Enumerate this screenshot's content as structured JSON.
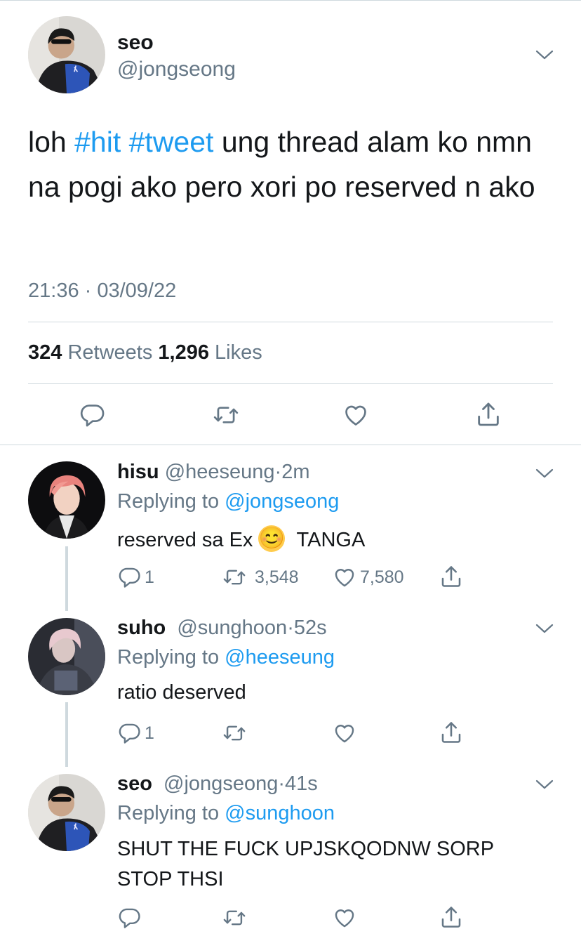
{
  "main_tweet": {
    "display_name": "seo",
    "handle": "@jongseong",
    "text_parts": [
      "loh ",
      "#hit",
      " ",
      "#tweet",
      " ung thread alam ko nmn na pogi ako pero xori po reserved n ako"
    ],
    "timestamp": "21:36 · 03/09/22",
    "retweets_count": "324",
    "retweets_label": "Retweets",
    "likes_count": "1,296",
    "likes_label": "Likes"
  },
  "replies": [
    {
      "display_name": "hisu",
      "handle": "@heeseung",
      "age": "2m",
      "replying_label": "Replying to",
      "replying_to": "@jongseong",
      "text_before": "reserved sa Ex",
      "emoji": "😊",
      "text_after": "TANGA",
      "reply_count": "1",
      "retweet_count": "3,548",
      "like_count": "7,580"
    },
    {
      "display_name": "suho",
      "handle": "@sunghoon",
      "age": "52s",
      "replying_label": "Replying to",
      "replying_to": "@heeseung",
      "text": "ratio deserved",
      "reply_count": "1"
    },
    {
      "display_name": "seo",
      "handle": "@jongseong",
      "age": "41s",
      "replying_label": "Replying to",
      "replying_to": "@sunghoon",
      "text_line1": "SHUT THE FUCK UPJSKQODNW SORP",
      "text_line2": "STOP THSI"
    }
  ],
  "icons": [
    "chevron-down-icon",
    "reply-icon",
    "retweet-icon",
    "like-icon",
    "share-icon"
  ],
  "colors": {
    "link": "#1d9bf0",
    "secondary_text": "#657786",
    "divider": "#cfd9de",
    "text": "#14171a"
  }
}
